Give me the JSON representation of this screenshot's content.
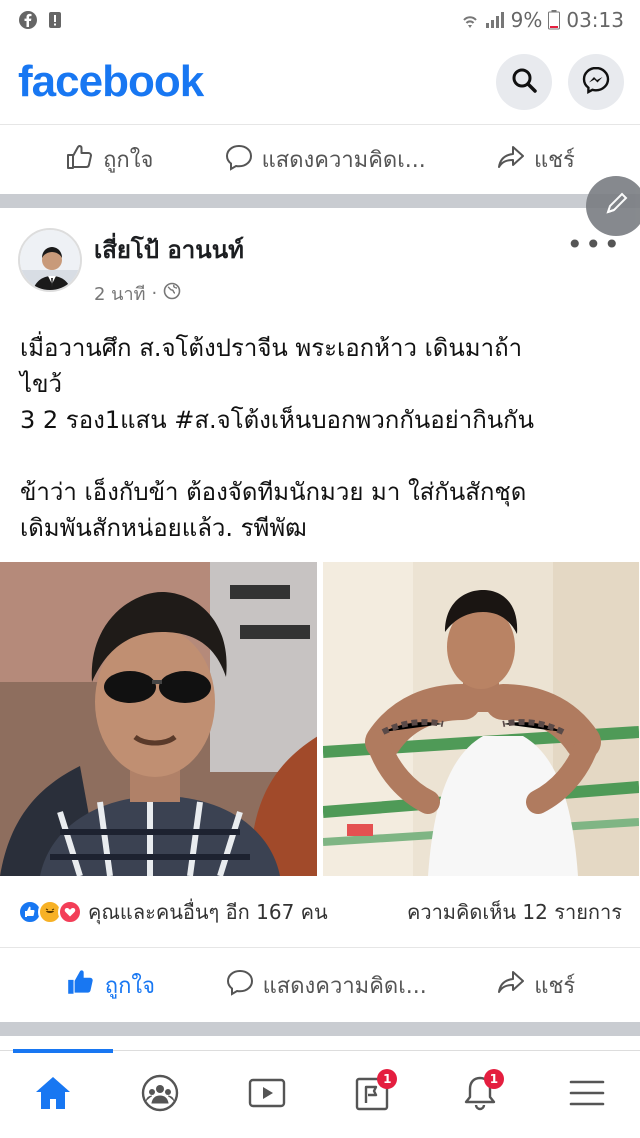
{
  "status_bar": {
    "battery": "9%",
    "time": "03:13"
  },
  "header": {
    "logo": "facebook",
    "search_icon": "search-icon",
    "messenger_icon": "messenger-icon"
  },
  "prev_post_actions": {
    "like": "ถูกใจ",
    "comment": "แสดงความคิดเ...",
    "share": "แชร์"
  },
  "post": {
    "author": "เสี่ยโป้ อานนท์",
    "time": "2 นาที",
    "text_lines": [
      "เมื่อวานศึก ส.จโต้งปราจีน พระเอกห้าว เดินมาถ้า",
      "ไขว้",
      "3 2 รอง1แสน  #ส.จโต้งเห็นบอกพวกกันอย่ากินกัน",
      "ข้าว่า เอ็งกับข้า   ต้องจัดทีมนักมวย มา ใส่กันสักชุด",
      "เดิมพันสักหน่อยแล้ว. รพีพัฒ"
    ],
    "likes_text": "คุณและคนอื่นๆ อีก 167 คน",
    "comments_text": "ความคิดเห็น 12 รายการ",
    "actions": {
      "like": "ถูกใจ",
      "comment": "แสดงความคิดเ...",
      "share": "แชร์"
    }
  },
  "bottom_nav": {
    "pages_badge": "1",
    "notifications_badge": "1"
  },
  "colors": {
    "brand": "#1877f2",
    "divider": "#c9ccd1",
    "badge": "#e41e3f"
  }
}
